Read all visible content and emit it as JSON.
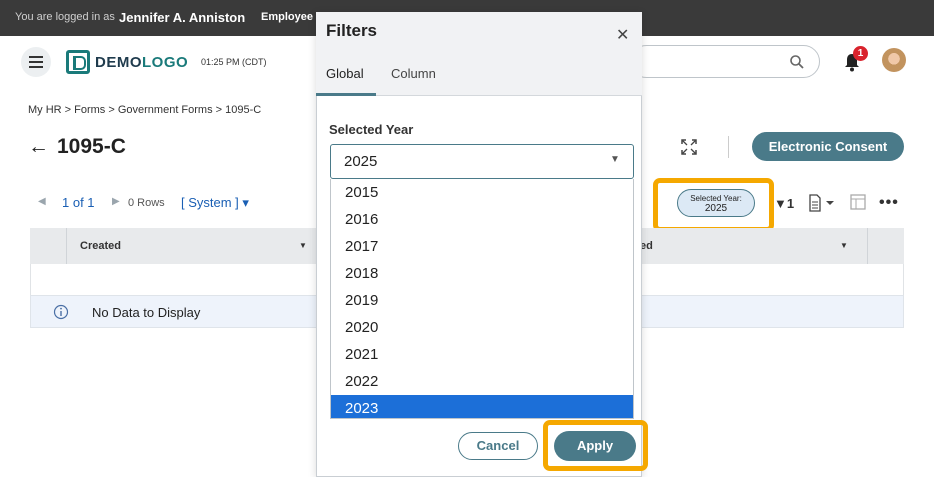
{
  "topbar": {
    "logged_in_label": "You are logged in as",
    "user_name": "Jennifer A. Anniston",
    "employee_label": "Employee I"
  },
  "header": {
    "logo_part1": "DEMO",
    "logo_part2": "LOGO",
    "time": "01:25 PM (CDT)",
    "notification_count": "1"
  },
  "breadcrumb": "My HR > Forms > Government Forms > 1095-C",
  "page": {
    "back_arrow": "←",
    "title": "1095-C",
    "consent_button": "Electronic Consent"
  },
  "toolbar": {
    "pager": "1 of 1",
    "rows": "0 Rows",
    "view": "[ System ] ▾",
    "chip_label": "Selected Year:",
    "chip_value": "2025",
    "filter_count": "1"
  },
  "table": {
    "col1": "Created",
    "col2_partial": "ed",
    "no_data": "No Data to Display"
  },
  "modal": {
    "title": "Filters",
    "tabs": [
      "Global",
      "Column"
    ],
    "field_label": "Selected Year",
    "selected_value": "2025",
    "options": [
      "2015",
      "2016",
      "2017",
      "2018",
      "2019",
      "2020",
      "2021",
      "2022",
      "2023"
    ],
    "highlighted_option": "2023",
    "cancel_label": "Cancel",
    "apply_label": "Apply"
  }
}
